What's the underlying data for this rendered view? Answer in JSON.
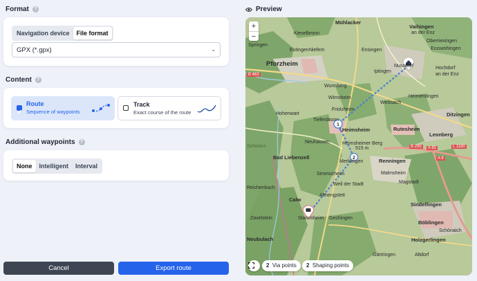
{
  "format": {
    "title": "Format",
    "tabs": [
      "Navigation device",
      "File format"
    ],
    "active_tab": "File format",
    "selected_format": "GPX (*.gpx)"
  },
  "content": {
    "title": "Content",
    "route": {
      "title": "Route",
      "subtitle": "Sequence of waypoints",
      "checked": true
    },
    "track": {
      "title": "Track",
      "subtitle": "Exact course of the route",
      "checked": false
    }
  },
  "waypoints": {
    "title": "Additional waypoints",
    "options": [
      "None",
      "Intelligent",
      "Interval"
    ],
    "active": "None"
  },
  "buttons": {
    "cancel": "Cancel",
    "export": "Export route"
  },
  "preview": {
    "title": "Preview",
    "zoom_in": "+",
    "zoom_out": "−",
    "via_count": "2",
    "via_label": "Via points",
    "shaping_count": "2",
    "shaping_label": "Shaping points",
    "labels": {
      "muhlacker": "Mühlacker",
      "vaihingen": "Vaihingen",
      "an_der_enz": "an der Enz",
      "kieselbronn": "Kieselbronn",
      "oberriexingen": "Oberriexingen",
      "springen": "Springen",
      "eutingen": "Eutingen",
      "niefern": "Niefern",
      "ensingen": "Ensingen",
      "enzweihingen": "Enzweihingen",
      "pforzheim": "Pforzheim",
      "iptingen": "Iptingen",
      "nussdorf": "Nussdorf",
      "hochdorf": "Hochdorf",
      "hochdorf_sub": "an der Enz",
      "b463": "B 463",
      "wurmberg": "Wurmberg",
      "heimerdingen": "Heimerdingen",
      "weissach": "Weissach",
      "ditzingen": "Ditzingen",
      "wimsheim": "Wimsheim",
      "friolzheim": "Friolzheim",
      "hohenwart": "Hohenwart",
      "tiefenbronn": "Tiefenbronn",
      "heimsheim": "Heimsheim",
      "rutesheim": "Rutesheim",
      "leonberg": "Leonberg",
      "b295": "B 295",
      "a81": "A 81",
      "l1180": "L 1180",
      "a8": "A 8",
      "neuhausen": "Neuhausen",
      "heimsheimer_berg": "Heimsheimer Berg",
      "berg_elev": "515 m",
      "schwarzwald": "Schwarz-",
      "bad_liebenzell": "Bad Liebenzell",
      "merklingen": "Merklingen",
      "renningen": "Renningen",
      "simmozheim": "Simmozheim",
      "weil_der_stadt": "Weil der Stadt",
      "malmsheim": "Malmsheim",
      "magstadt": "Magstadt",
      "reichenbach": "Reichenbach",
      "calw": "Calw",
      "althengstett": "Althengstett",
      "sindelfingen": "Sindelfingen",
      "zavelstein": "Zavelstein",
      "stammheim": "Stammheim",
      "gechingen": "Gechingen",
      "boblingen": "Böblingen",
      "neubulach": "Neubulach",
      "holzgerlingen": "Holzgerlingen",
      "schonaich": "Schönaich",
      "gartringen": "Gärtringen",
      "altdorf": "Altdorf"
    }
  },
  "colors": {
    "accent": "#2563eb",
    "route_card_bg": "#dbe6fa",
    "cancel_bg": "#3f4653",
    "map_forest": "#7fa66a",
    "map_field": "#d9dcc0",
    "route_line": "#4a7fcf"
  }
}
